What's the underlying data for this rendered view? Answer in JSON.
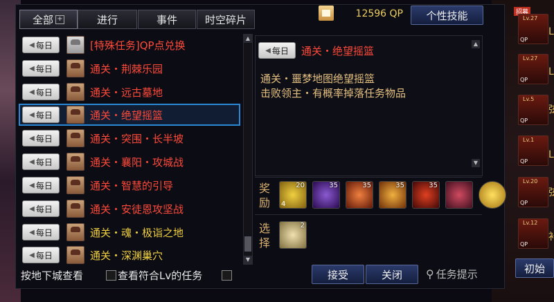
{
  "tabs": [
    {
      "label": "全部",
      "active": true,
      "has_plus": true
    },
    {
      "label": "进行"
    },
    {
      "label": "事件"
    },
    {
      "label": "时空碎片"
    }
  ],
  "qp": {
    "value": "12596 QP",
    "skill_button": "个性技能"
  },
  "daily_label": "每日",
  "quests": [
    {
      "name": "[特殊任务]QP点兑换",
      "color": "#ff4a3a",
      "avatar": "gray"
    },
    {
      "name": "通关・荆棘乐园",
      "color": "#ff4a3a",
      "avatar": "npc"
    },
    {
      "name": "通关・远古墓地",
      "color": "#ff4a3a",
      "avatar": "npc"
    },
    {
      "name": "通关・绝望摇篮",
      "color": "#ff4a3a",
      "avatar": "npc",
      "selected": true
    },
    {
      "name": "通关・突围・长半坡",
      "color": "#ff4a3a",
      "avatar": "npc"
    },
    {
      "name": "通关・襄阳・攻城战",
      "color": "#ff4a3a",
      "avatar": "npc"
    },
    {
      "name": "通关・智慧的引导",
      "color": "#ff4a3a",
      "avatar": "npc"
    },
    {
      "name": "通关・安徒恩攻坚战",
      "color": "#ff4a3a",
      "avatar": "npc"
    },
    {
      "name": "通关・魂・极诣之地",
      "color": "#f0d040",
      "avatar": "npc"
    },
    {
      "name": "通关・深渊巢穴",
      "color": "#f0d040",
      "avatar": "npc"
    }
  ],
  "detail": {
    "title": "通关・绝望摇篮",
    "line1": "通关・噩梦地图绝望摇篮",
    "line2": "击败领主・有概率掉落任务物品"
  },
  "reward_label": "奖励",
  "select_label": "选择",
  "rewards": [
    {
      "icon": "gold-bar-icon",
      "count": "20",
      "count2": "4",
      "bg": "#c8a020"
    },
    {
      "icon": "purple-orb-icon",
      "count": "35",
      "bg": "#4a2a8a"
    },
    {
      "icon": "fire-weapon-icon",
      "count": "35",
      "bg": "#b04020"
    },
    {
      "icon": "gold-armor-icon",
      "count": "35",
      "bg": "#d08020"
    },
    {
      "icon": "red-orb-icon",
      "count": "35",
      "bg": "#902010"
    },
    {
      "icon": "treasure-chest-icon",
      "count": "",
      "bg": "#8a3040"
    },
    {
      "icon": "gold-coin-icon",
      "count": "",
      "bg": "#e0b020"
    }
  ],
  "choice": {
    "icon": "scroll-icon",
    "count": "2"
  },
  "bottom": {
    "dungeon_view": "按地下城查看",
    "filter_lv": "查看符合Lv的任务",
    "accept": "接受",
    "close": "关闭",
    "hint": "任务提示"
  },
  "side": {
    "top_badge": "招募",
    "levels": [
      "Lv.27",
      "Lv.27",
      "Lv.5",
      "Lv.1",
      "Lv.20",
      "Lv.12"
    ],
    "slot_label": "QP",
    "texts": [
      "L",
      "L",
      "弦",
      "L",
      "弦",
      "补"
    ],
    "init_button": "初始"
  }
}
